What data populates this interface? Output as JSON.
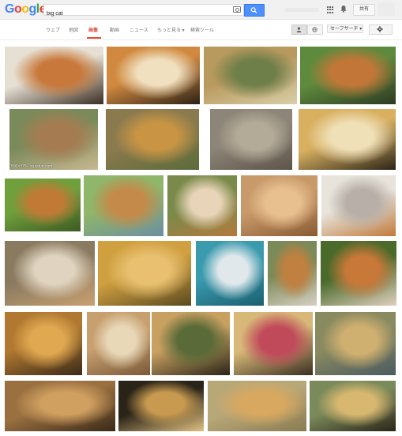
{
  "logo": {
    "letters": [
      "G",
      "o",
      "o",
      "g",
      "l",
      "e"
    ]
  },
  "search": {
    "query": "big cat"
  },
  "header": {
    "share_label": "共有"
  },
  "tabs": [
    {
      "label": "ウェブ",
      "active": false
    },
    {
      "label": "地図",
      "active": false
    },
    {
      "label": "画像",
      "active": true
    },
    {
      "label": "動画",
      "active": false
    },
    {
      "label": "ニュース",
      "active": false
    },
    {
      "label": "もっと見る ▾",
      "active": false
    },
    {
      "label": "検索ツール",
      "active": false
    }
  ],
  "toolbar": {
    "safesearch_label": "セーフサーチ ▾"
  },
  "results": {
    "caption_4": "500×375 - zuzafun.com",
    "images": [
      {
        "subject": "white and orange tigers lying",
        "colors": [
          "#e6e0d4",
          "#c8783a",
          "#3b2e22"
        ]
      },
      {
        "subject": "tiger close-up",
        "colors": [
          "#d0893e",
          "#f0e0c0",
          "#2c2116"
        ]
      },
      {
        "subject": "lion lying on grass",
        "colors": [
          "#b99a5e",
          "#6f7f4a",
          "#d9cfaa"
        ]
      },
      {
        "subject": "tiger walking",
        "colors": [
          "#5e8a3d",
          "#c27738",
          "#2d3a22"
        ]
      },
      {
        "subject": "tigers in water tank",
        "colors": [
          "#7b8a5a",
          "#a57c52",
          "#c9b892"
        ]
      },
      {
        "subject": "big cats collage",
        "colors": [
          "#8b7a4e",
          "#c99544",
          "#5a6b3a"
        ]
      },
      {
        "subject": "pallas cat",
        "colors": [
          "#8d8577",
          "#b3aa98",
          "#5c544a"
        ]
      },
      {
        "subject": "snarling leopard",
        "colors": [
          "#d8b060",
          "#f0e0b8",
          "#2c2418"
        ]
      },
      {
        "subject": "tiger on lawn",
        "colors": [
          "#6fa03c",
          "#c07a36",
          "#3d5a22"
        ]
      },
      {
        "subject": "tiger in water tub",
        "colors": [
          "#8fb66a",
          "#c48a4a",
          "#6c8ea0"
        ]
      },
      {
        "subject": "woman with tiger",
        "colors": [
          "#7a8a4a",
          "#e8d4b8",
          "#b27a3e"
        ]
      },
      {
        "subject": "orange cat lying",
        "colors": [
          "#c89a6a",
          "#e8c090",
          "#8a5a32"
        ]
      },
      {
        "subject": "white tiger sleeping",
        "colors": [
          "#e8e4dc",
          "#b8b0a8",
          "#c07a3a"
        ]
      },
      {
        "subject": "cats sleeping with cheetah",
        "colors": [
          "#8a7a60",
          "#e0d4c0",
          "#c8a070"
        ]
      },
      {
        "subject": "orange cat face",
        "colors": [
          "#d0a040",
          "#e8c070",
          "#5a4a20"
        ]
      },
      {
        "subject": "white tiger underwater",
        "colors": [
          "#3a9aae",
          "#e0e8ec",
          "#1a6070"
        ]
      },
      {
        "subject": "woman with tiger standing",
        "colors": [
          "#7a8a58",
          "#c08040",
          "#d8d0c4"
        ]
      },
      {
        "subject": "couple with tiger",
        "colors": [
          "#4a6a2a",
          "#c87838",
          "#e0d0c0"
        ]
      },
      {
        "subject": "lion and tiger",
        "colors": [
          "#b07830",
          "#e0a850",
          "#3a2a18"
        ]
      },
      {
        "subject": "lion with toy",
        "colors": [
          "#c8a070",
          "#e8d8b8",
          "#7a5a38"
        ]
      },
      {
        "subject": "leopard on branch",
        "colors": [
          "#c8a060",
          "#5a6a38",
          "#2a2418"
        ]
      },
      {
        "subject": "yawning leopard",
        "colors": [
          "#d8b878",
          "#c04a5a",
          "#3a3020"
        ]
      },
      {
        "subject": "jaguar in water",
        "colors": [
          "#8a8a60",
          "#d0b070",
          "#4a5a60"
        ]
      },
      {
        "subject": "lion lying",
        "colors": [
          "#9a7040",
          "#d0a060",
          "#3a2818"
        ]
      },
      {
        "subject": "snarling leopard dark",
        "colors": [
          "#2a2418",
          "#c89a50",
          "#e0c080"
        ]
      },
      {
        "subject": "lion cubs",
        "colors": [
          "#b8a878",
          "#d8a860",
          "#8a7a50"
        ]
      },
      {
        "subject": "serval hissing",
        "colors": [
          "#7a8a5a",
          "#d8b870",
          "#2a2418"
        ]
      }
    ]
  }
}
